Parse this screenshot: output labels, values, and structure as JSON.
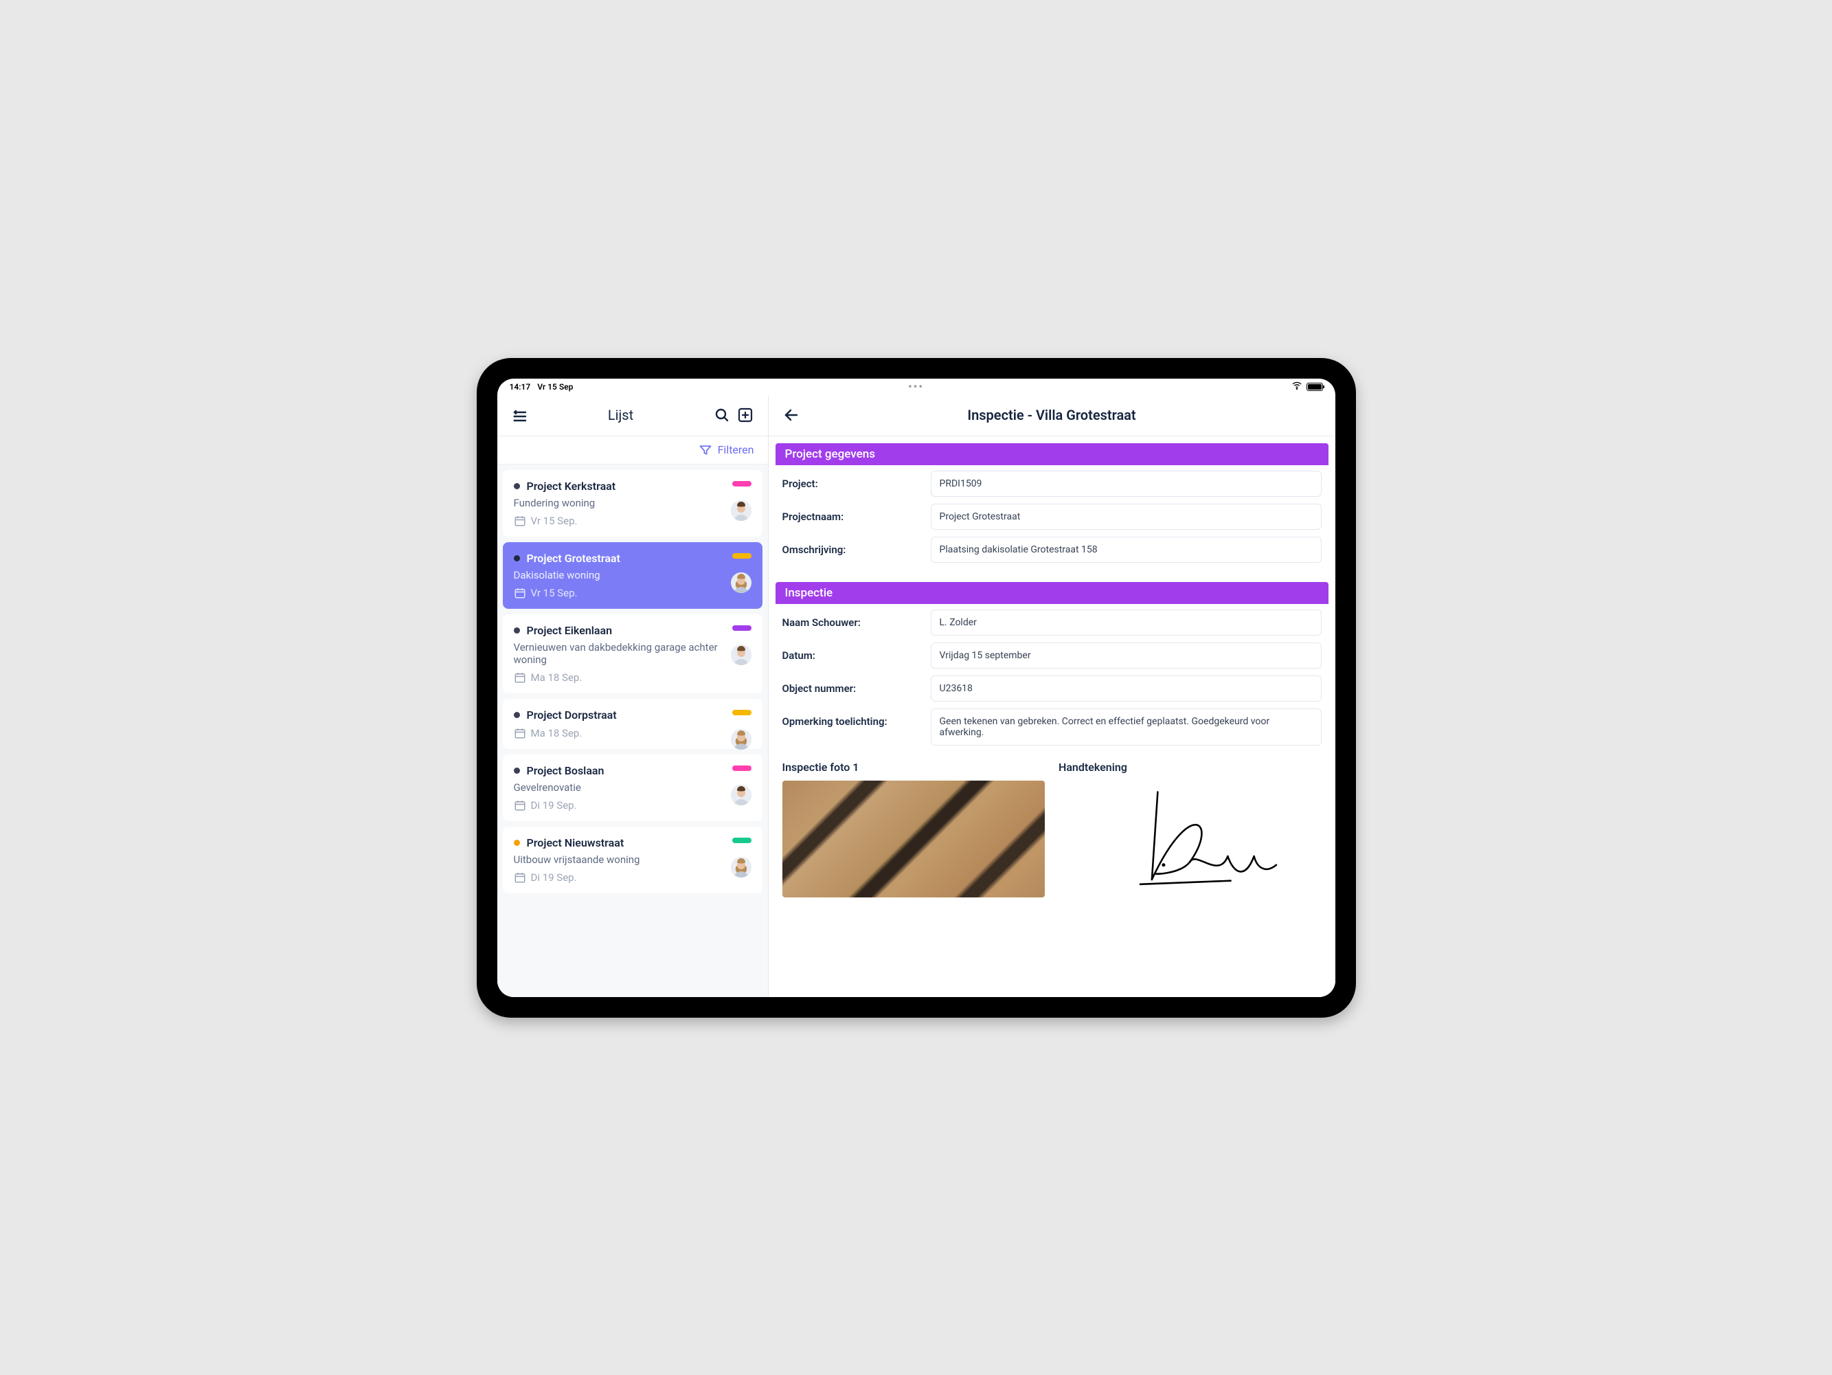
{
  "status": {
    "time": "14:17",
    "date": "Vr 15 Sep"
  },
  "sidebar": {
    "title": "Lijst",
    "filter_label": "Filteren",
    "items": [
      {
        "title": "Project Kerkstraat",
        "subtitle": "Fundering woning",
        "date": "Vr 15 Sep.",
        "dot_color": "#3a3f52",
        "pill_color": "#ff3fb0",
        "selected": false,
        "avatar": "man1"
      },
      {
        "title": "Project Grotestraat",
        "subtitle": "Dakisolatie woning",
        "date": "Vr 15 Sep.",
        "dot_color": "#1e293b",
        "pill_color": "#f5b700",
        "selected": true,
        "avatar": "woman1"
      },
      {
        "title": "Project Eikenlaan",
        "subtitle": "Vernieuwen van dakbedekking garage achter woning",
        "date": "Ma 18 Sep.",
        "dot_color": "#3a3f52",
        "pill_color": "#a23deb",
        "selected": false,
        "avatar": "man2"
      },
      {
        "title": "Project Dorpstraat",
        "subtitle": "",
        "date": "Ma 18 Sep.",
        "dot_color": "#3a3f52",
        "pill_color": "#f5b700",
        "selected": false,
        "avatar": "woman2"
      },
      {
        "title": "Project Boslaan",
        "subtitle": "Gevelrenovatie",
        "date": "Di 19 Sep.",
        "dot_color": "#3a3f52",
        "pill_color": "#ff3fb0",
        "selected": false,
        "avatar": "man1"
      },
      {
        "title": "Project Nieuwstraat",
        "subtitle": "Uitbouw vrijstaande woning",
        "date": "Di 19 Sep.",
        "dot_color": "#f5a100",
        "pill_color": "#17c98a",
        "selected": false,
        "avatar": "woman1"
      }
    ]
  },
  "main": {
    "title": "Inspectie - Villa Grotestraat",
    "sections": {
      "project": {
        "header": "Project gegevens",
        "fields": [
          {
            "label": "Project:",
            "value": "PRDI1509"
          },
          {
            "label": "Projectnaam:",
            "value": "Project Grotestraat"
          },
          {
            "label": "Omschrijving:",
            "value": "Plaatsing dakisolatie Grotestraat 158"
          }
        ]
      },
      "inspectie": {
        "header": "Inspectie",
        "fields": [
          {
            "label": "Naam Schouwer:",
            "value": "L. Zolder"
          },
          {
            "label": "Datum:",
            "value": "Vrijdag 15 september"
          },
          {
            "label": "Object nummer:",
            "value": "U23618"
          },
          {
            "label": "Opmerking toelichting:",
            "value": "Geen tekenen van gebreken. Correct en effectief geplaatst. Goedgekeurd voor afwerking."
          }
        ],
        "photo1_label": "Inspectie foto 1",
        "signature_label": "Handtekening"
      }
    }
  },
  "colors": {
    "accent": "#a23deb",
    "primary_selected": "#7c7df6",
    "filter_link": "#6b6cf2"
  }
}
